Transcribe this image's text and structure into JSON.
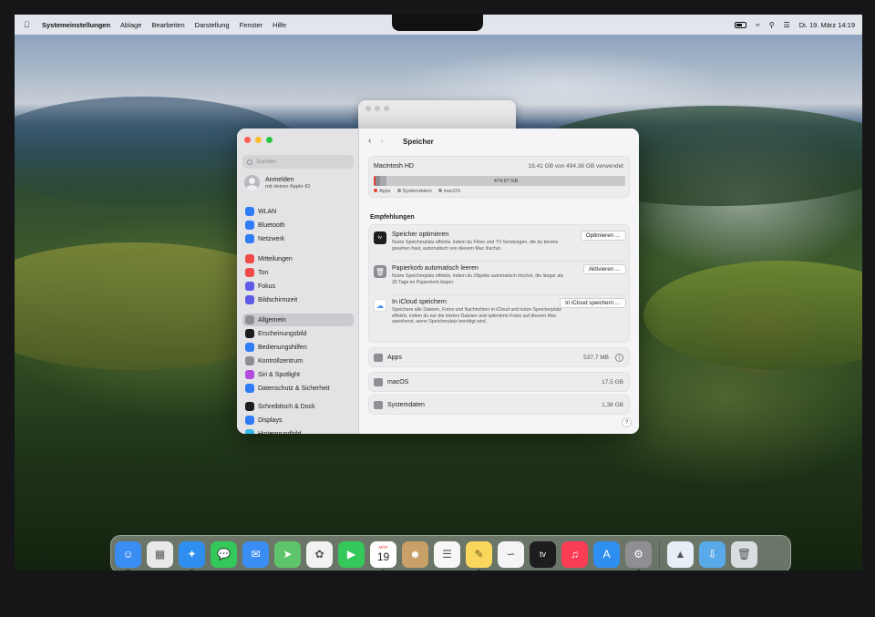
{
  "menubar": {
    "app_name": "Systemeinstellungen",
    "items": [
      "Ablage",
      "Bearbeiten",
      "Darstellung",
      "Fenster",
      "Hilfe"
    ],
    "datetime": "Di. 19. März 14:19"
  },
  "sidebar": {
    "search_placeholder": "Suchen",
    "account_title": "Anmelden",
    "account_subtitle": "mit deiner Apple-ID",
    "items": [
      {
        "label": "WLAN",
        "icon": "wifi-icon",
        "color": "#2f7cf6"
      },
      {
        "label": "Bluetooth",
        "icon": "bluetooth-icon",
        "color": "#2f7cf6"
      },
      {
        "label": "Netzwerk",
        "icon": "globe-icon",
        "color": "#2f7cf6"
      },
      {
        "label": "Mitteilungen",
        "icon": "bell-icon",
        "color": "#f24a48"
      },
      {
        "label": "Ton",
        "icon": "speaker-icon",
        "color": "#f24a48"
      },
      {
        "label": "Fokus",
        "icon": "moon-icon",
        "color": "#5e5ce6"
      },
      {
        "label": "Bildschirmzeit",
        "icon": "hourglass-icon",
        "color": "#5e5ce6"
      },
      {
        "label": "Allgemein",
        "icon": "gear-icon",
        "color": "#8e8e93"
      },
      {
        "label": "Erscheinungsbild",
        "icon": "appearance-icon",
        "color": "#1d1d1f"
      },
      {
        "label": "Bedienungshilfen",
        "icon": "accessibility-icon",
        "color": "#2f7cf6"
      },
      {
        "label": "Kontrollzentrum",
        "icon": "control-center-icon",
        "color": "#8e8e93"
      },
      {
        "label": "Siri & Spotlight",
        "icon": "siri-icon",
        "color": "#b34ce0"
      },
      {
        "label": "Datenschutz & Sicherheit",
        "icon": "hand-icon",
        "color": "#2f7cf6"
      },
      {
        "label": "Schreibtisch & Dock",
        "icon": "dock-icon",
        "color": "#1d1d1f"
      },
      {
        "label": "Displays",
        "icon": "sun-icon",
        "color": "#2f7cf6"
      },
      {
        "label": "Hintergrundbild",
        "icon": "wallpaper-icon",
        "color": "#35b5e8"
      }
    ]
  },
  "content": {
    "title": "Speicher",
    "disk": {
      "name": "Macintosh HD",
      "usage": "19,41 GB von 494,38 GB verwendet",
      "free_label": "474,97 GB",
      "used_fraction": 0.039,
      "legend": [
        {
          "label": "Apps",
          "color": "#e5412f"
        },
        {
          "label": "Systemdaten",
          "color": "#8e8e93"
        },
        {
          "label": "macOS",
          "color": "#8e8e93"
        }
      ]
    },
    "recommendations_title": "Empfehlungen",
    "recommendations": [
      {
        "title": "Speicher optimieren",
        "desc": "Nutze Speicherplatz effektiv, indem du Filme und TV-Sendungen, die du bereits gesehen hast, automatisch von diesem Mac löschst.",
        "button": "Optimieren …",
        "icon": "appletv-icon"
      },
      {
        "title": "Papierkorb automatisch leeren",
        "desc": "Nutze Speicherplatz effektiv, indem du Objekte automatisch löschst, die länger als 30 Tage im Papierkorb liegen.",
        "button": "Aktivieren …",
        "icon": "trash-icon"
      },
      {
        "title": "In iCloud speichern",
        "desc": "Speichere alle Dateien, Fotos und Nachrichten in iCloud und nutze Speicherplatz effektiv, indem du nur die letzten Dateien und optimierte Fotos auf diesem Mac speicherst, wenn Speicherplatz benötigt wird.",
        "button": "In iCloud speichern …",
        "icon": "icloud-icon"
      }
    ],
    "categories": [
      {
        "name": "Apps",
        "size": "537,7 MB",
        "icon": "apps-icon"
      },
      {
        "name": "macOS",
        "size": "17,5 GB",
        "icon": "macos-icon"
      },
      {
        "name": "Systemdaten",
        "size": "1,38 GB",
        "icon": "system-data-icon"
      }
    ],
    "help_label": "?"
  },
  "dock": {
    "calendar_month": "MÄR",
    "calendar_day": "19",
    "apps": [
      {
        "name": "finder-icon",
        "color": "#3a8df3"
      },
      {
        "name": "launchpad-icon",
        "color": "#e8e8ea"
      },
      {
        "name": "safari-icon",
        "color": "#2f8ff0"
      },
      {
        "name": "messages-icon",
        "color": "#34c759"
      },
      {
        "name": "mail-icon",
        "color": "#3a8df3"
      },
      {
        "name": "maps-icon",
        "color": "#5ec46b"
      },
      {
        "name": "photos-icon",
        "color": "#f2f2f2"
      },
      {
        "name": "facetime-icon",
        "color": "#34c759"
      },
      {
        "name": "calendar-icon",
        "color": "#ffffff"
      },
      {
        "name": "contacts-icon",
        "color": "#c9a068"
      },
      {
        "name": "reminders-icon",
        "color": "#f7f7f7"
      },
      {
        "name": "notes-icon",
        "color": "#f9d65c"
      },
      {
        "name": "freeform-icon",
        "color": "#f4f4f6"
      },
      {
        "name": "appletv-icon",
        "color": "#1d1d1f"
      },
      {
        "name": "music-icon",
        "color": "#fa3c55"
      },
      {
        "name": "appstore-icon",
        "color": "#2f8ff0"
      },
      {
        "name": "system-settings-icon",
        "color": "#8e8e93"
      },
      {
        "name": "preview-icon",
        "color": "#e8eef6"
      },
      {
        "name": "downloads-folder-icon",
        "color": "#5aa9e8"
      },
      {
        "name": "trash-icon",
        "color": "#d9dce0"
      }
    ]
  }
}
